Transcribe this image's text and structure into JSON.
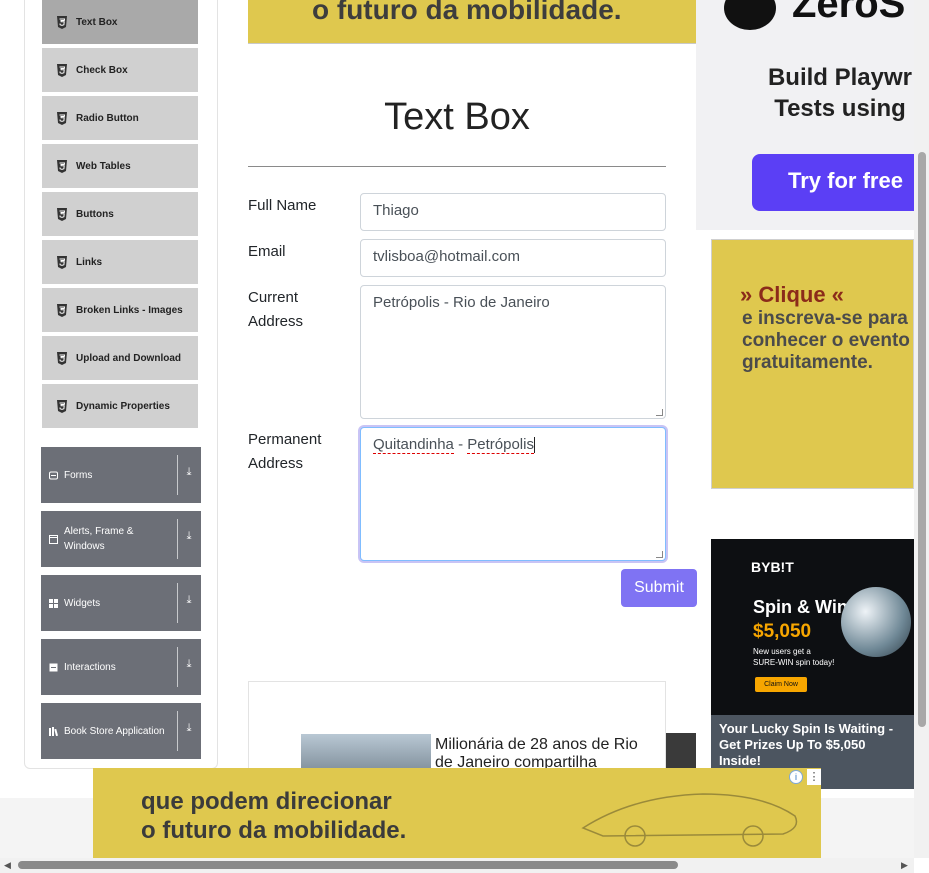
{
  "sidebar": {
    "elements_items": [
      {
        "label": "Text Box",
        "active": true
      },
      {
        "label": "Check Box"
      },
      {
        "label": "Radio Button"
      },
      {
        "label": "Web Tables"
      },
      {
        "label": "Buttons"
      },
      {
        "label": "Links"
      },
      {
        "label": "Broken Links - Images"
      },
      {
        "label": "Upload and Download"
      },
      {
        "label": "Dynamic Properties"
      }
    ],
    "groups": [
      {
        "label": "Forms"
      },
      {
        "label": "Alerts, Frame & Windows"
      },
      {
        "label": "Widgets"
      },
      {
        "label": "Interactions"
      },
      {
        "label": "Book Store Application"
      }
    ]
  },
  "top_banner": {
    "text": "o futuro da mobilidade."
  },
  "main": {
    "title": "Text Box",
    "form": {
      "full_name_label": "Full Name",
      "full_name_value": "Thiago",
      "email_label": "Email",
      "email_value": "tvlisboa@hotmail.com",
      "current_address_label_1": "Current",
      "current_address_label_2": "Address",
      "current_address_value": "Petrópolis - Rio de Janeiro",
      "permanent_address_label_1": "Permanent",
      "permanent_address_label_2": "Address",
      "permanent_address_word1": "Quitandinha",
      "permanent_address_sep": " - ",
      "permanent_address_word2": "Petrópolis",
      "submit_label": "Submit"
    },
    "ad_article": {
      "text": "Milionária de 28 anos de Rio de Janeiro compartilha"
    }
  },
  "right_ads": {
    "zerostep": {
      "brand": "ZeroS",
      "headline_1": "Build Playwr",
      "headline_2": "Tests using",
      "button": "Try for free"
    },
    "event": {
      "headline": "» Clique «",
      "body_1": "e inscreva-se para",
      "body_2": "conhecer o evento",
      "body_3": "gratuitamente."
    },
    "bybit": {
      "logo": "BYB!T",
      "headline": "Spin & Win",
      "amount": "$5,050",
      "small_1": "New users get a",
      "small_2": "SURE-WIN spin today!",
      "claim": "Claim Now",
      "footer": "Your Lucky Spin Is Waiting - Get Prizes Up To $5,050 Inside!"
    }
  },
  "bottom_banner": {
    "line1": "que podem direcionar",
    "line2": "o futuro da mobilidade."
  },
  "colors": {
    "accent": "#7f73f3",
    "sidebar_group": "#6c6f77",
    "ad_yellow": "#dfc84e"
  }
}
